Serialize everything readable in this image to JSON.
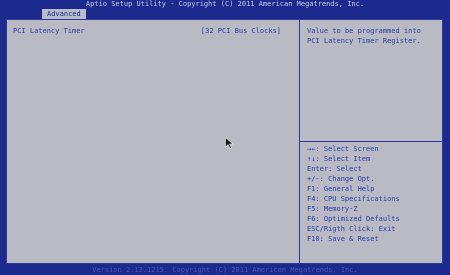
{
  "header": {
    "title": "Aptio Setup Utility - Copyright (C) 2011 American Megatrends, Inc."
  },
  "tabs": [
    {
      "label": "Advanced"
    }
  ],
  "settings": [
    {
      "label": "PCI Latency Timer",
      "value": "[32 PCI Bus Clocks]"
    }
  ],
  "help": {
    "text": "Value to be programmed into PCI Latency Timer Register."
  },
  "keys": [
    "→←: Select Screen",
    "↑↓: Select Item",
    "Enter: Select",
    "+/-: Change Opt.",
    "F1: General Help",
    "F4: CPU Specifications",
    "F5: Memory-Z",
    "F6: Optimized Defaults",
    "ESC/Rigth Click: Exit",
    "F10: Save & Reset"
  ],
  "footer": {
    "text": "Version 2.13.1215. Copyright (C) 2011 American Megatrends, Inc."
  },
  "colors": {
    "background": "#1b2a8c",
    "panel": "#b9bac4",
    "text": "#2a3aa8"
  }
}
